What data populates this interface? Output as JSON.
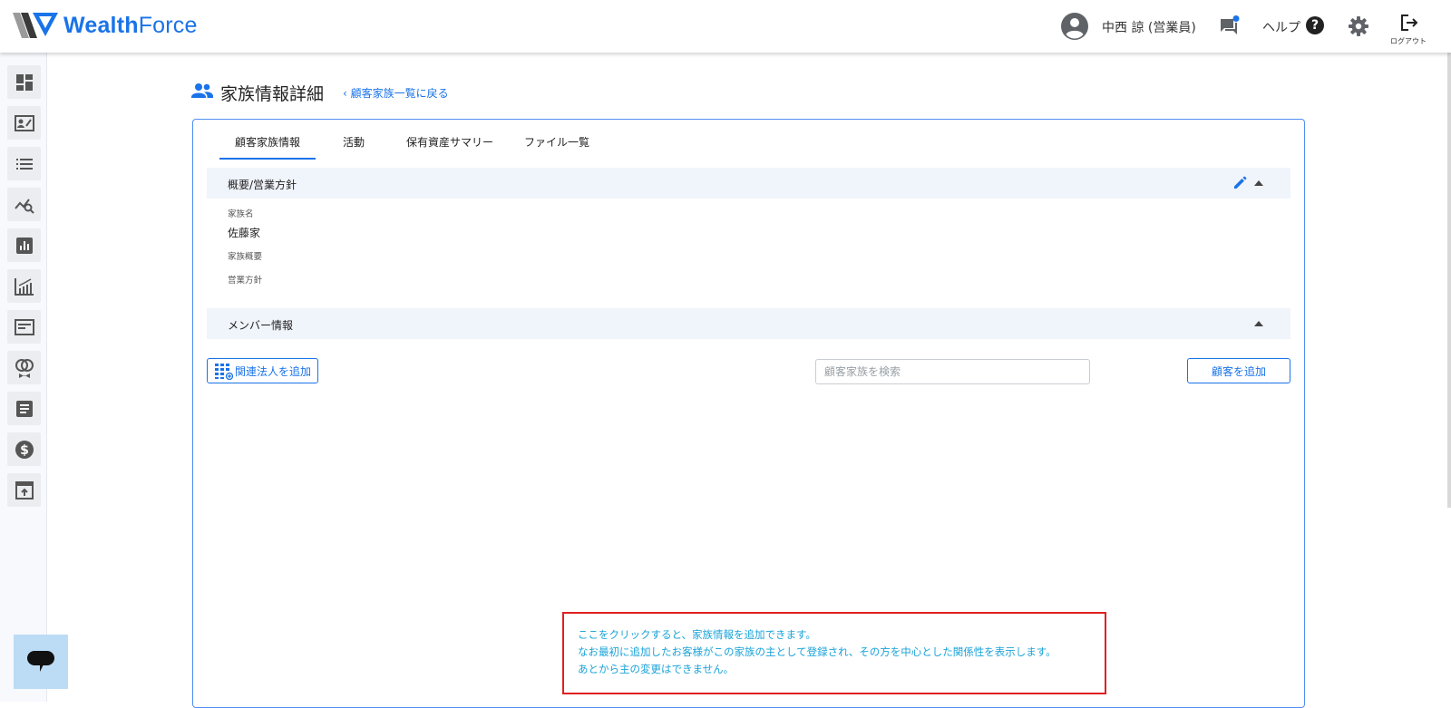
{
  "app": {
    "brand_bold": "Wealth",
    "brand_light": "Force",
    "accent_color": "#1a73e8"
  },
  "header": {
    "user_name": "中西 諒 (営業員)",
    "help_label": "ヘルプ",
    "help_glyph": "?",
    "logout_label": "ログアウト",
    "icons": [
      "account-circle-icon",
      "chat-icon",
      "help-icon",
      "gear-icon",
      "logout-icon"
    ]
  },
  "sidebar": {
    "items": [
      {
        "icon": "dashboard-icon"
      },
      {
        "icon": "contact-card-icon"
      },
      {
        "icon": "list-icon"
      },
      {
        "icon": "chart-search-icon"
      },
      {
        "icon": "bar-chart-icon"
      },
      {
        "icon": "growth-chart-icon"
      },
      {
        "icon": "document-icon"
      },
      {
        "icon": "award-icon"
      },
      {
        "icon": "article-icon"
      },
      {
        "icon": "dollar-icon"
      },
      {
        "icon": "open-in-icon"
      }
    ]
  },
  "page": {
    "title": "家族情報詳細",
    "back_link": "顧客家族一覧に戻る",
    "back_chevron": "‹"
  },
  "tabs": [
    {
      "label": "顧客家族情報",
      "active": true
    },
    {
      "label": "活動",
      "active": false
    },
    {
      "label": "保有資産サマリー",
      "active": false
    },
    {
      "label": "ファイル一覧",
      "active": false
    }
  ],
  "overview": {
    "title": "概要/営業方針",
    "family_name_label": "家族名",
    "family_name_value": "佐藤家",
    "family_summary_label": "家族概要",
    "sales_policy_label": "営業方針"
  },
  "members": {
    "title": "メンバー情報",
    "add_corp_button": "関連法人を追加",
    "search_placeholder": "顧客家族を検索",
    "add_customer_button": "顧客を追加"
  },
  "tooltip": {
    "lines": [
      "ここをクリックすると、家族情報を追加できます。",
      "なお最初に追加したお客様がこの家族の主として登録され、その方を中心とした関係性を表示します。",
      "あとから主の変更はできません。"
    ],
    "border_color": "#e02020",
    "text_color": "#1aa3d8"
  }
}
